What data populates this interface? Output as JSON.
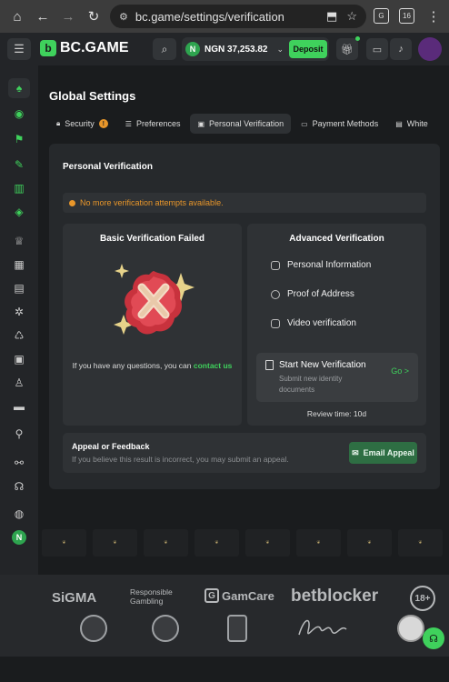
{
  "browser": {
    "url": "bc.game/settings/verification"
  },
  "header": {
    "logo_text": "BC.GAME",
    "currency_symbol": "N",
    "balance": "NGN 37,253.82",
    "deposit_label": "Deposit"
  },
  "settings": {
    "title": "Global Settings",
    "tabs": [
      {
        "label": "Security",
        "icon": "lock-icon",
        "warning": "!"
      },
      {
        "label": "Preferences",
        "icon": "sliders-icon"
      },
      {
        "label": "Personal Verification",
        "icon": "id-card-icon"
      },
      {
        "label": "Payment Methods",
        "icon": "card-icon"
      },
      {
        "label": "White",
        "icon": "list-icon"
      }
    ]
  },
  "verification": {
    "title": "Personal Verification",
    "alert": "No more verification attempts available.",
    "basic": {
      "title": "Basic Verification Failed",
      "help_text": "If you have any questions, you can ",
      "contact_link": "contact us"
    },
    "advanced": {
      "title": "Advanced Verification",
      "items": [
        "Personal Information",
        "Proof of Address",
        "Video verification"
      ],
      "new_title": "Start New Verification",
      "new_sub": "Submit new identity documents",
      "go_label": "Go >",
      "review_time": "Review time: 10d"
    },
    "appeal": {
      "title": "Appeal or Feedback",
      "text": "If you believe this result is incorrect, you may submit an appeal.",
      "button": "Email Appeal"
    }
  },
  "footer": {
    "sigma": "SiGMA",
    "responsible": "Responsible Gambling",
    "gamcare": "GamCare",
    "betblocker": "betblocker",
    "age": "18+"
  },
  "colors": {
    "accent": "#3fd15c",
    "warning": "#e8962a",
    "background": "#1a1c1e",
    "panel": "#26292c"
  }
}
